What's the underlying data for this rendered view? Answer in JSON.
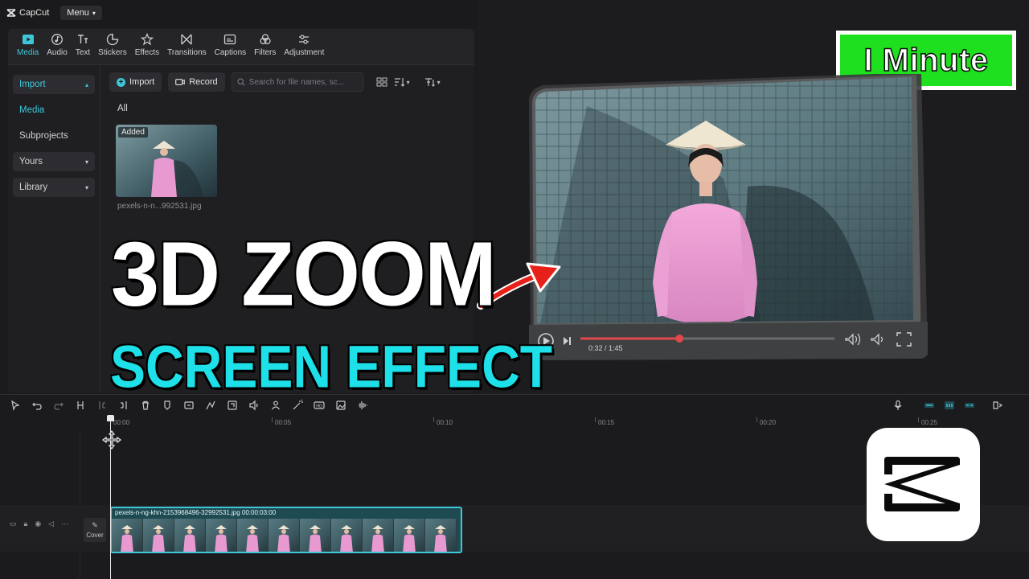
{
  "app": {
    "name": "CapCut",
    "menu_label": "Menu"
  },
  "toolbar": {
    "tabs": [
      {
        "label": "Media",
        "icon": "media-icon",
        "active": true
      },
      {
        "label": "Audio",
        "icon": "audio-icon"
      },
      {
        "label": "Text",
        "icon": "text-icon"
      },
      {
        "label": "Stickers",
        "icon": "stickers-icon"
      },
      {
        "label": "Effects",
        "icon": "effects-icon"
      },
      {
        "label": "Transitions",
        "icon": "transitions-icon"
      },
      {
        "label": "Captions",
        "icon": "captions-icon"
      },
      {
        "label": "Filters",
        "icon": "filters-icon"
      },
      {
        "label": "Adjustment",
        "icon": "adjustment-icon"
      }
    ]
  },
  "sidebar": {
    "items": [
      {
        "label": "Import",
        "expanded": true
      },
      {
        "label": "Media"
      },
      {
        "label": "Subprojects"
      },
      {
        "label": "Yours"
      },
      {
        "label": "Library"
      }
    ]
  },
  "media": {
    "import_label": "Import",
    "record_label": "Record",
    "search_placeholder": "Search for file names, sc...",
    "filter_label": "All",
    "items": [
      {
        "badge": "Added",
        "filename": "pexels-n-n...992531.jpg"
      }
    ]
  },
  "preview": {
    "badge_text": "I Minute",
    "player": {
      "time": "0:32 / 1:45",
      "progress": 0.39
    }
  },
  "overlay": {
    "title_line1": "3D ZOOM",
    "title_line2": "SCREEN EFFECT"
  },
  "timeline": {
    "ruler": [
      "00:00",
      "00:05",
      "00:10",
      "00:15",
      "00:20",
      "00:25"
    ],
    "clip": {
      "label": "pexels-n-ng-khn-2153968496-32992531.jpg   00:00:03:00",
      "frame_count": 11
    },
    "cover_label": "Cover"
  },
  "colors": {
    "accent": "#3ec6d9",
    "badge_green": "#1ee01e",
    "title_cyan": "#1ee0e8",
    "player_red": "#e0484a"
  }
}
